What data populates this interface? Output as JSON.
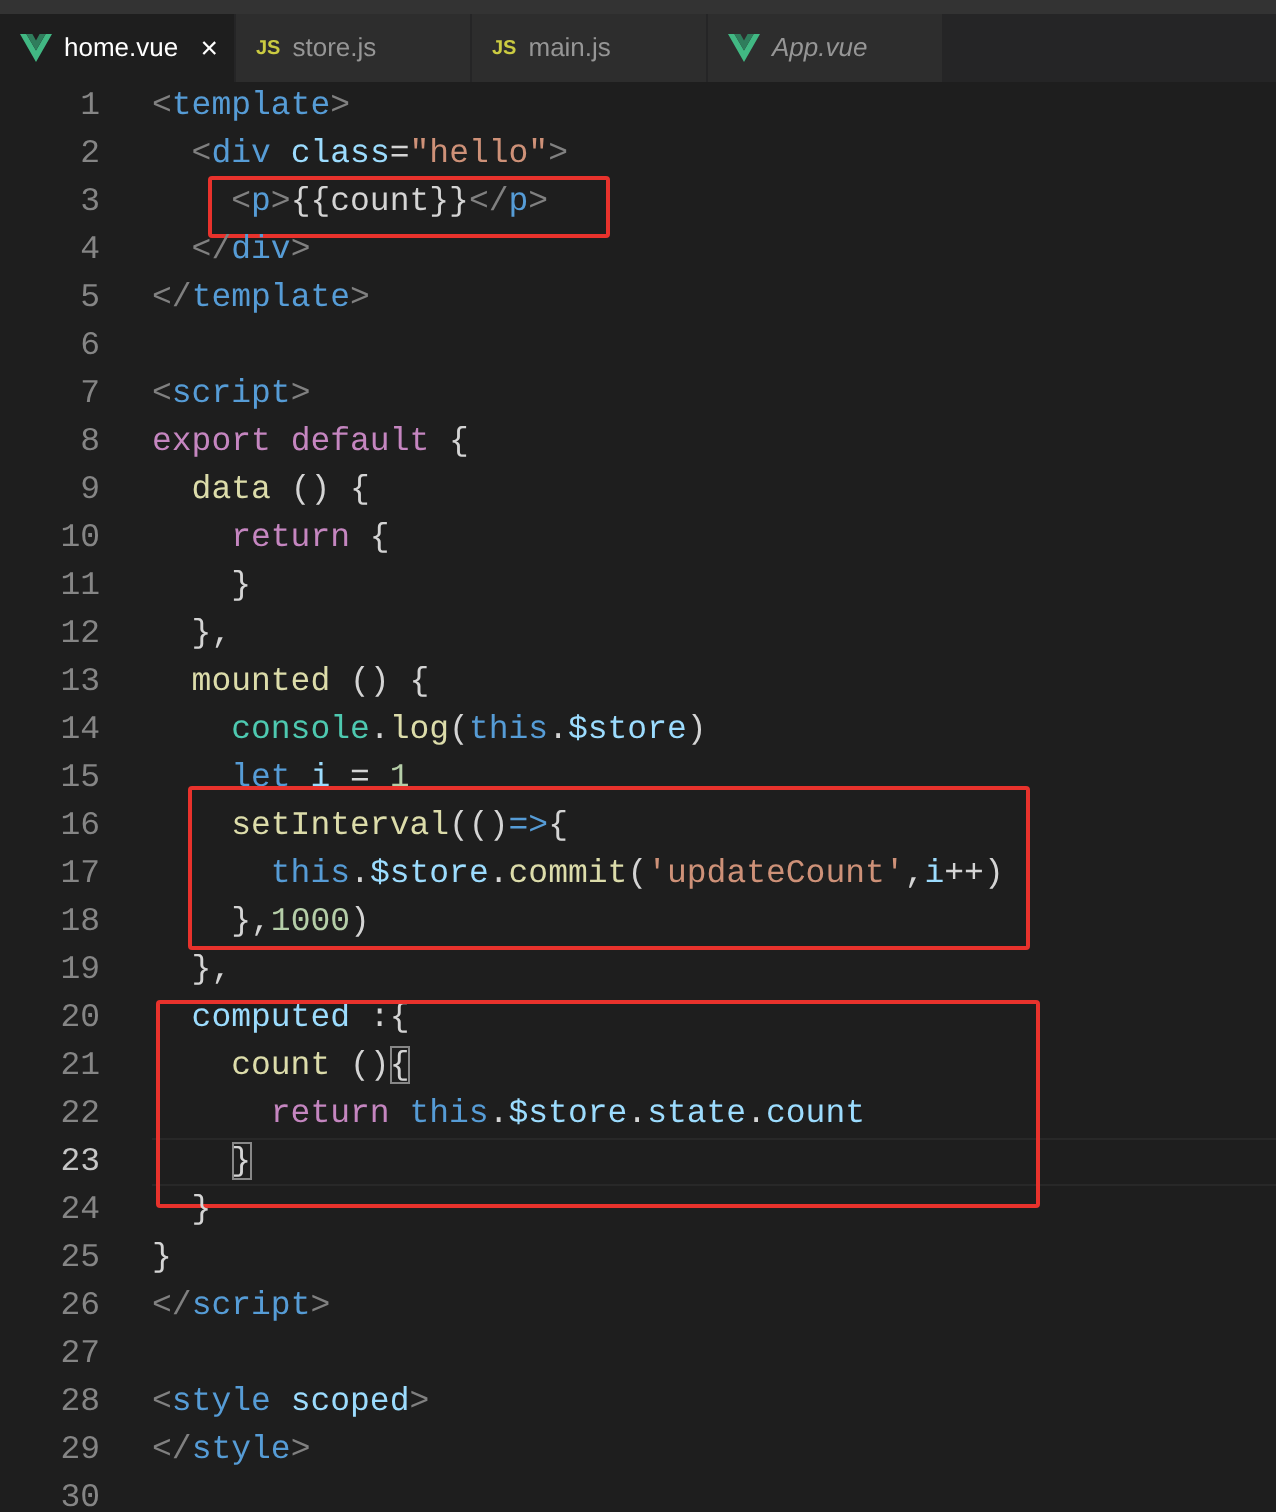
{
  "tabs": [
    {
      "label": "home.vue",
      "kind": "vue",
      "selected": true,
      "italic": false,
      "close": "×"
    },
    {
      "label": "store.js",
      "kind": "js",
      "badge": "JS",
      "selected": false,
      "italic": false
    },
    {
      "label": "main.js",
      "kind": "js",
      "badge": "JS",
      "selected": false,
      "italic": false
    },
    {
      "label": "App.vue",
      "kind": "vue",
      "selected": false,
      "italic": true
    }
  ],
  "segments": [
    {
      "highlighted": false,
      "lines": [
        {
          "number": "1",
          "current": false,
          "tokens": [
            {
              "kind": "punct",
              "text": "<"
            },
            {
              "kind": "tag",
              "text": "template"
            },
            {
              "kind": "punct",
              "text": ">"
            }
          ]
        },
        {
          "number": "2",
          "current": false,
          "tokens": [
            {
              "kind": "punct",
              "text": "  <"
            },
            {
              "kind": "tag",
              "text": "div"
            },
            {
              "kind": "attr",
              "text": " class"
            },
            {
              "kind": "text",
              "text": "="
            },
            {
              "kind": "str",
              "text": "\"hello\""
            },
            {
              "kind": "punct",
              "text": ">"
            }
          ]
        }
      ]
    },
    {
      "highlighted": true,
      "lines": [
        {
          "number": "3",
          "current": false,
          "tokens": [
            {
              "kind": "punct",
              "text": "    <"
            },
            {
              "kind": "tag",
              "text": "p"
            },
            {
              "kind": "punct",
              "text": ">"
            },
            {
              "kind": "text",
              "text": "{{count}}"
            },
            {
              "kind": "punct",
              "text": "</"
            },
            {
              "kind": "tag",
              "text": "p"
            },
            {
              "kind": "punct",
              "text": ">"
            }
          ]
        }
      ]
    },
    {
      "highlighted": false,
      "lines": [
        {
          "number": "4",
          "current": false,
          "tokens": [
            {
              "kind": "punct",
              "text": "  </"
            },
            {
              "kind": "tag",
              "text": "div"
            },
            {
              "kind": "punct",
              "text": ">"
            }
          ]
        },
        {
          "number": "5",
          "current": false,
          "tokens": [
            {
              "kind": "punct",
              "text": "</"
            },
            {
              "kind": "tag",
              "text": "template"
            },
            {
              "kind": "punct",
              "text": ">"
            }
          ]
        },
        {
          "number": "6",
          "current": false
        },
        {
          "number": "7",
          "current": false,
          "tokens": [
            {
              "kind": "punct",
              "text": "<"
            },
            {
              "kind": "tag",
              "text": "script"
            },
            {
              "kind": "punct",
              "text": ">"
            }
          ]
        },
        {
          "number": "8",
          "current": false,
          "tokens": [
            {
              "kind": "ctl",
              "text": "export"
            },
            {
              "kind": "ctl",
              "text": " default"
            },
            {
              "kind": "text",
              "text": " {"
            }
          ]
        },
        {
          "number": "9",
          "current": false,
          "tokens": [
            {
              "kind": "fn",
              "text": "  data"
            },
            {
              "kind": "text",
              "text": " () {"
            }
          ]
        },
        {
          "number": "10",
          "current": false,
          "tokens": [
            {
              "kind": "ctl",
              "text": "    return"
            },
            {
              "kind": "text",
              "text": " {"
            }
          ]
        },
        {
          "number": "11",
          "current": false,
          "tokens": [
            {
              "kind": "text",
              "text": "    }"
            }
          ]
        },
        {
          "number": "12",
          "current": false,
          "tokens": [
            {
              "kind": "text",
              "text": "  },"
            }
          ]
        },
        {
          "number": "13",
          "current": false,
          "tokens": [
            {
              "kind": "fn",
              "text": "  mounted"
            },
            {
              "kind": "text",
              "text": " () {"
            }
          ]
        },
        {
          "number": "14",
          "current": false,
          "tokens": [
            {
              "kind": "cls",
              "text": "    console"
            },
            {
              "kind": "text",
              "text": "."
            },
            {
              "kind": "fn",
              "text": "log"
            },
            {
              "kind": "text",
              "text": "("
            },
            {
              "kind": "kw",
              "text": "this"
            },
            {
              "kind": "text",
              "text": "."
            },
            {
              "kind": "var",
              "text": "$store"
            },
            {
              "kind": "text",
              "text": ")"
            }
          ]
        },
        {
          "number": "15",
          "current": false,
          "tokens": [
            {
              "kind": "kw",
              "text": "    let"
            },
            {
              "kind": "var",
              "text": " i"
            },
            {
              "kind": "text",
              "text": " = "
            },
            {
              "kind": "num",
              "text": "1"
            }
          ]
        }
      ]
    },
    {
      "highlighted": true,
      "lines": [
        {
          "number": "16",
          "current": false,
          "tokens": [
            {
              "kind": "fn",
              "text": "    setInterval"
            },
            {
              "kind": "text",
              "text": "(()"
            },
            {
              "kind": "kw",
              "text": "=>"
            },
            {
              "kind": "text",
              "text": "{"
            }
          ]
        },
        {
          "number": "17",
          "current": false,
          "tokens": [
            {
              "kind": "kw",
              "text": "      this"
            },
            {
              "kind": "text",
              "text": "."
            },
            {
              "kind": "var",
              "text": "$store"
            },
            {
              "kind": "text",
              "text": "."
            },
            {
              "kind": "fn",
              "text": "commit"
            },
            {
              "kind": "text",
              "text": "("
            },
            {
              "kind": "str",
              "text": "'updateCount'"
            },
            {
              "kind": "text",
              "text": ","
            },
            {
              "kind": "var",
              "text": "i"
            },
            {
              "kind": "text",
              "text": "++)"
            }
          ]
        },
        {
          "number": "18",
          "current": false,
          "tokens": [
            {
              "kind": "text",
              "text": "    },"
            },
            {
              "kind": "num",
              "text": "1000"
            },
            {
              "kind": "text",
              "text": ")"
            }
          ]
        }
      ]
    },
    {
      "highlighted": false,
      "lines": [
        {
          "number": "19",
          "current": false,
          "tokens": [
            {
              "kind": "text",
              "text": "  },"
            }
          ]
        }
      ]
    },
    {
      "highlighted": true,
      "lines": [
        {
          "number": "20",
          "current": false,
          "tokens": [
            {
              "kind": "var",
              "text": "  computed"
            },
            {
              "kind": "text",
              "text": " :{"
            }
          ]
        },
        {
          "number": "21",
          "current": false,
          "tokens": [
            {
              "kind": "fn",
              "text": "    count"
            },
            {
              "kind": "text",
              "text": " ()"
            },
            {
              "kind": "match",
              "text": "{"
            }
          ]
        },
        {
          "number": "22",
          "current": false,
          "tokens": [
            {
              "kind": "ctl",
              "text": "      return"
            },
            {
              "kind": "kw",
              "text": " this"
            },
            {
              "kind": "text",
              "text": "."
            },
            {
              "kind": "var",
              "text": "$store"
            },
            {
              "kind": "text",
              "text": "."
            },
            {
              "kind": "var",
              "text": "state"
            },
            {
              "kind": "text",
              "text": "."
            },
            {
              "kind": "var",
              "text": "count"
            }
          ]
        },
        {
          "number": "23",
          "current": true,
          "tokens": [
            {
              "kind": "match",
              "text": "    }"
            }
          ]
        }
      ]
    },
    {
      "highlighted": false,
      "lines": [
        {
          "number": "24",
          "current": false,
          "tokens": [
            {
              "kind": "text",
              "text": "  }"
            }
          ]
        },
        {
          "number": "25",
          "current": false,
          "tokens": [
            {
              "kind": "text",
              "text": "}"
            }
          ]
        },
        {
          "number": "26",
          "current": false,
          "tokens": [
            {
              "kind": "punct",
              "text": "</"
            },
            {
              "kind": "tag",
              "text": "script"
            },
            {
              "kind": "punct",
              "text": ">"
            }
          ]
        },
        {
          "number": "27",
          "current": false
        },
        {
          "number": "28",
          "current": false,
          "tokens": [
            {
              "kind": "punct",
              "text": "<"
            },
            {
              "kind": "tag",
              "text": "style"
            },
            {
              "kind": "attr",
              "text": " scoped"
            },
            {
              "kind": "punct",
              "text": ">"
            }
          ]
        },
        {
          "number": "29",
          "current": false,
          "tokens": [
            {
              "kind": "punct",
              "text": "</"
            },
            {
              "kind": "tag",
              "text": "style"
            },
            {
              "kind": "punct",
              "text": ">"
            }
          ]
        },
        {
          "number": "30",
          "current": false
        }
      ]
    }
  ]
}
